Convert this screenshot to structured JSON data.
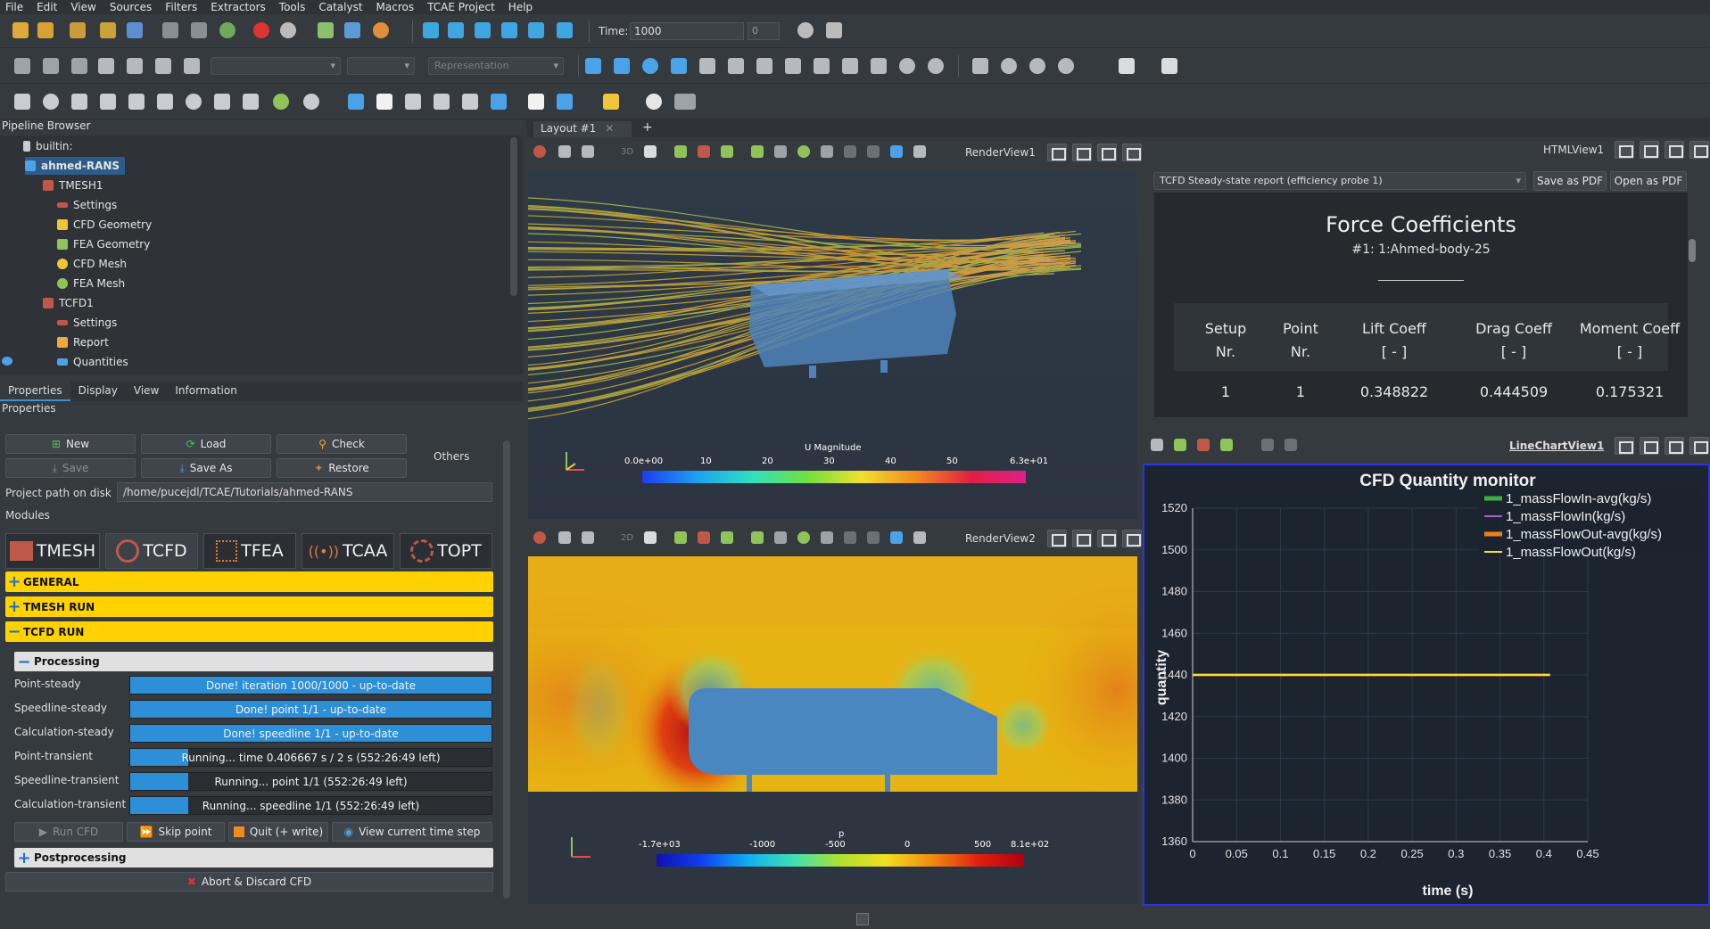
{
  "menu": [
    "File",
    "Edit",
    "View",
    "Sources",
    "Filters",
    "Extractors",
    "Tools",
    "Catalyst",
    "Macros",
    "TCAE Project",
    "Help"
  ],
  "time_toolbar": {
    "label": "Time:",
    "value": "1000",
    "index": "0"
  },
  "representation_placeholder": "Representation",
  "pipeline": {
    "title": "Pipeline Browser",
    "items": [
      {
        "label": "builtin:"
      },
      {
        "label": "ahmed-RANS"
      },
      {
        "label": "TMESH1"
      },
      {
        "label": "Settings"
      },
      {
        "label": "CFD Geometry"
      },
      {
        "label": "FEA Geometry"
      },
      {
        "label": "CFD Mesh"
      },
      {
        "label": "FEA Mesh"
      },
      {
        "label": "TCFD1"
      },
      {
        "label": "Settings"
      },
      {
        "label": "Report"
      },
      {
        "label": "Quantities"
      }
    ]
  },
  "props_tabs": [
    "Properties",
    "Display",
    "View",
    "Information"
  ],
  "properties_title": "Properties",
  "buttons": {
    "new": "New",
    "load": "Load",
    "check": "Check",
    "others": "Others",
    "save": "Save",
    "save_as": "Save As",
    "restore": "Restore"
  },
  "project_path": {
    "label": "Project path on disk",
    "value": "/home/pucejdl/TCAE/Tutorials/ahmed-RANS"
  },
  "modules_label": "Modules",
  "modules": [
    "TMESH",
    "TCFD",
    "TFEA",
    "TCAA",
    "TOPT"
  ],
  "sections": {
    "general": "GENERAL",
    "tmesh_run": "TMESH RUN",
    "tcfd_run": "TCFD RUN",
    "processing": "Processing",
    "postprocessing": "Postprocessing"
  },
  "progress": [
    {
      "label": "Point-steady",
      "text": "Done! iteration 1000/1000 - up-to-date",
      "fraction": 1.0
    },
    {
      "label": "Speedline-steady",
      "text": "Done! point 1/1 - up-to-date",
      "fraction": 1.0
    },
    {
      "label": "Calculation-steady",
      "text": "Done! speedline 1/1 - up-to-date",
      "fraction": 1.0
    },
    {
      "label": "Point-transient",
      "text": "Running... time 0.406667 s / 2 s (552:26:49 left)",
      "fraction": 0.16
    },
    {
      "label": "Speedline-transient",
      "text": "Running... point 1/1 (552:26:49 left)",
      "fraction": 0.16
    },
    {
      "label": "Calculation-transient",
      "text": "Running... speedline 1/1 (552:26:49 left)",
      "fraction": 0.16
    }
  ],
  "run_buttons": {
    "run_cfd": "Run CFD",
    "skip": "Skip point",
    "quit": "Quit (+ write)",
    "view_ts": "View current time step"
  },
  "abort": "Abort & Discard CFD",
  "layout_tab": "Layout #1",
  "renderview1": {
    "name": "RenderView1",
    "legend_title": "U Magnitude",
    "ticks": [
      "0.0e+00",
      "10",
      "20",
      "30",
      "40",
      "50",
      "6.3e+01"
    ]
  },
  "renderview2": {
    "name": "RenderView2",
    "legend_title": "p",
    "ticks": [
      "-1.7e+03",
      "-1000",
      "-500",
      "0",
      "500",
      "8.1e+02"
    ]
  },
  "htmlview": {
    "name": "HTMLView1",
    "report_select": "TCFD Steady-state report (efficiency probe 1)",
    "save_pdf": "Save as PDF",
    "open_pdf": "Open as PDF",
    "title": "Force Coefficients",
    "subtitle": "#1: 1:Ahmed-body-25",
    "columns": [
      {
        "h1": "Setup",
        "h2": "Nr."
      },
      {
        "h1": "Point",
        "h2": "Nr."
      },
      {
        "h1": "Lift Coeff",
        "h2": "[ - ]"
      },
      {
        "h1": "Drag Coeff",
        "h2": "[ - ]"
      },
      {
        "h1": "Moment Coeff",
        "h2": "[ - ]"
      }
    ],
    "row": [
      "1",
      "1",
      "0.348822",
      "0.444509",
      "0.175321"
    ]
  },
  "linechart_name": "LineChartView1",
  "chart_data": {
    "type": "line",
    "title": "CFD Quantity monitor",
    "xlabel": "time (s)",
    "ylabel": "quantity",
    "xlim": [
      0,
      0.45
    ],
    "ylim": [
      1360,
      1520
    ],
    "xticks": [
      "0",
      "0.05",
      "0.1",
      "0.15",
      "0.2",
      "0.25",
      "0.3",
      "0.35",
      "0.4",
      "0.45"
    ],
    "yticks": [
      "1360",
      "1380",
      "1400",
      "1420",
      "1440",
      "1460",
      "1480",
      "1500",
      "1520"
    ],
    "grid": true,
    "legend_position": "top-right",
    "series": [
      {
        "name": "1_massFlowIn-avg(kg/s)",
        "color": "#3cb043",
        "x": [
          0,
          0.407
        ],
        "y": [
          1440,
          1440
        ]
      },
      {
        "name": "1_massFlowIn(kg/s)",
        "color": "#b05cc8",
        "x": [
          0,
          0.407
        ],
        "y": [
          1440,
          1440
        ]
      },
      {
        "name": "1_massFlowOut-avg(kg/s)",
        "color": "#f07f1a",
        "x": [
          0,
          0.407
        ],
        "y": [
          1440,
          1440
        ]
      },
      {
        "name": "1_massFlowOut(kg/s)",
        "color": "#f0e040",
        "x": [
          0,
          0.407
        ],
        "y": [
          1440,
          1440
        ]
      }
    ]
  }
}
